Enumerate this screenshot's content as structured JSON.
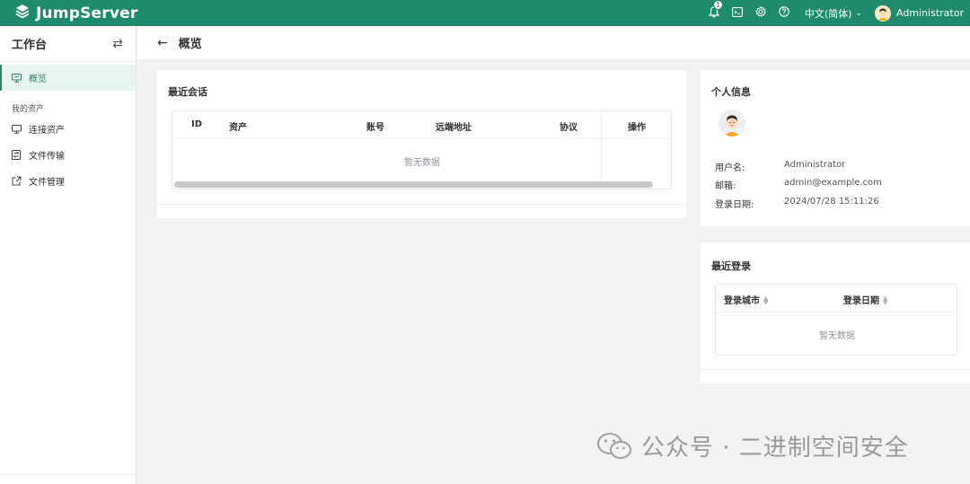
{
  "app": {
    "name": "JumpServer",
    "brand_color": "#1f8a6c"
  },
  "topbar": {
    "notification_count": "1",
    "language": "中文(简体)",
    "user_name": "Administrator"
  },
  "sidebar": {
    "title": "工作台",
    "items": [
      {
        "label": "概览",
        "icon": "monitor-icon",
        "active": true
      }
    ],
    "section_label": "我的资产",
    "asset_items": [
      {
        "label": "连接资产",
        "icon": "desktop-icon"
      },
      {
        "label": "文件传输",
        "icon": "file-transfer-icon"
      },
      {
        "label": "文件管理",
        "icon": "external-link-icon"
      }
    ]
  },
  "breadcrumb": {
    "title": "概览"
  },
  "recent_sessions": {
    "title": "最近会话",
    "columns": [
      "ID",
      "资产",
      "账号",
      "远端地址",
      "协议",
      "操作"
    ],
    "empty_text": "暂无数据"
  },
  "profile": {
    "title": "个人信息",
    "fields": [
      {
        "label": "用户名:",
        "value": "Administrator"
      },
      {
        "label": "邮箱:",
        "value": "admin@example.com"
      },
      {
        "label": "登录日期:",
        "value": "2024/07/28 15:11:26"
      }
    ]
  },
  "recent_logins": {
    "title": "最近登录",
    "columns": [
      "登录城市",
      "登录日期"
    ],
    "empty_text": "暂无数据"
  },
  "watermark": {
    "text": "公众号 · 二进制空间安全"
  }
}
